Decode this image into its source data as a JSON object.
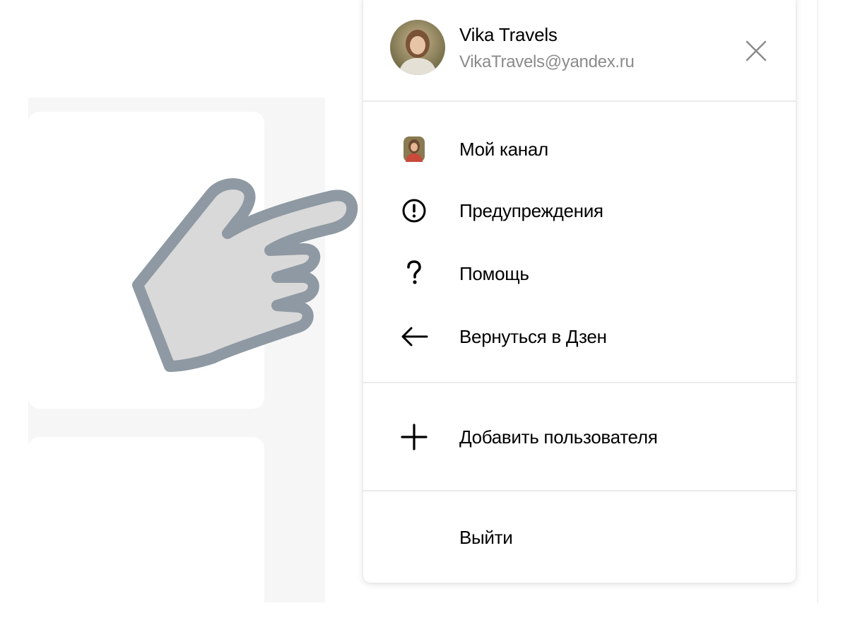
{
  "user": {
    "name": "Vika Travels",
    "email": "VikaTravels@yandex.ru"
  },
  "icons": {
    "avatar": "user-avatar-photo",
    "close": "close-icon",
    "channel": "channel-avatar-icon",
    "warnings": "exclamation-circle-icon",
    "help": "question-mark-icon",
    "back": "arrow-left-icon",
    "add": "plus-icon",
    "pointer": "pointing-hand-icon"
  },
  "menu": {
    "items": [
      {
        "label": "Мой канал"
      },
      {
        "label": "Предупреждения"
      },
      {
        "label": "Помощь"
      },
      {
        "label": "Вернуться в Дзен"
      }
    ],
    "add_user_label": "Добавить пользователя",
    "logout_label": "Выйти"
  },
  "colors": {
    "pointer_fill": "#d9d9d9",
    "pointer_stroke": "#8e99a3",
    "muted_text": "#8b8b8b"
  }
}
